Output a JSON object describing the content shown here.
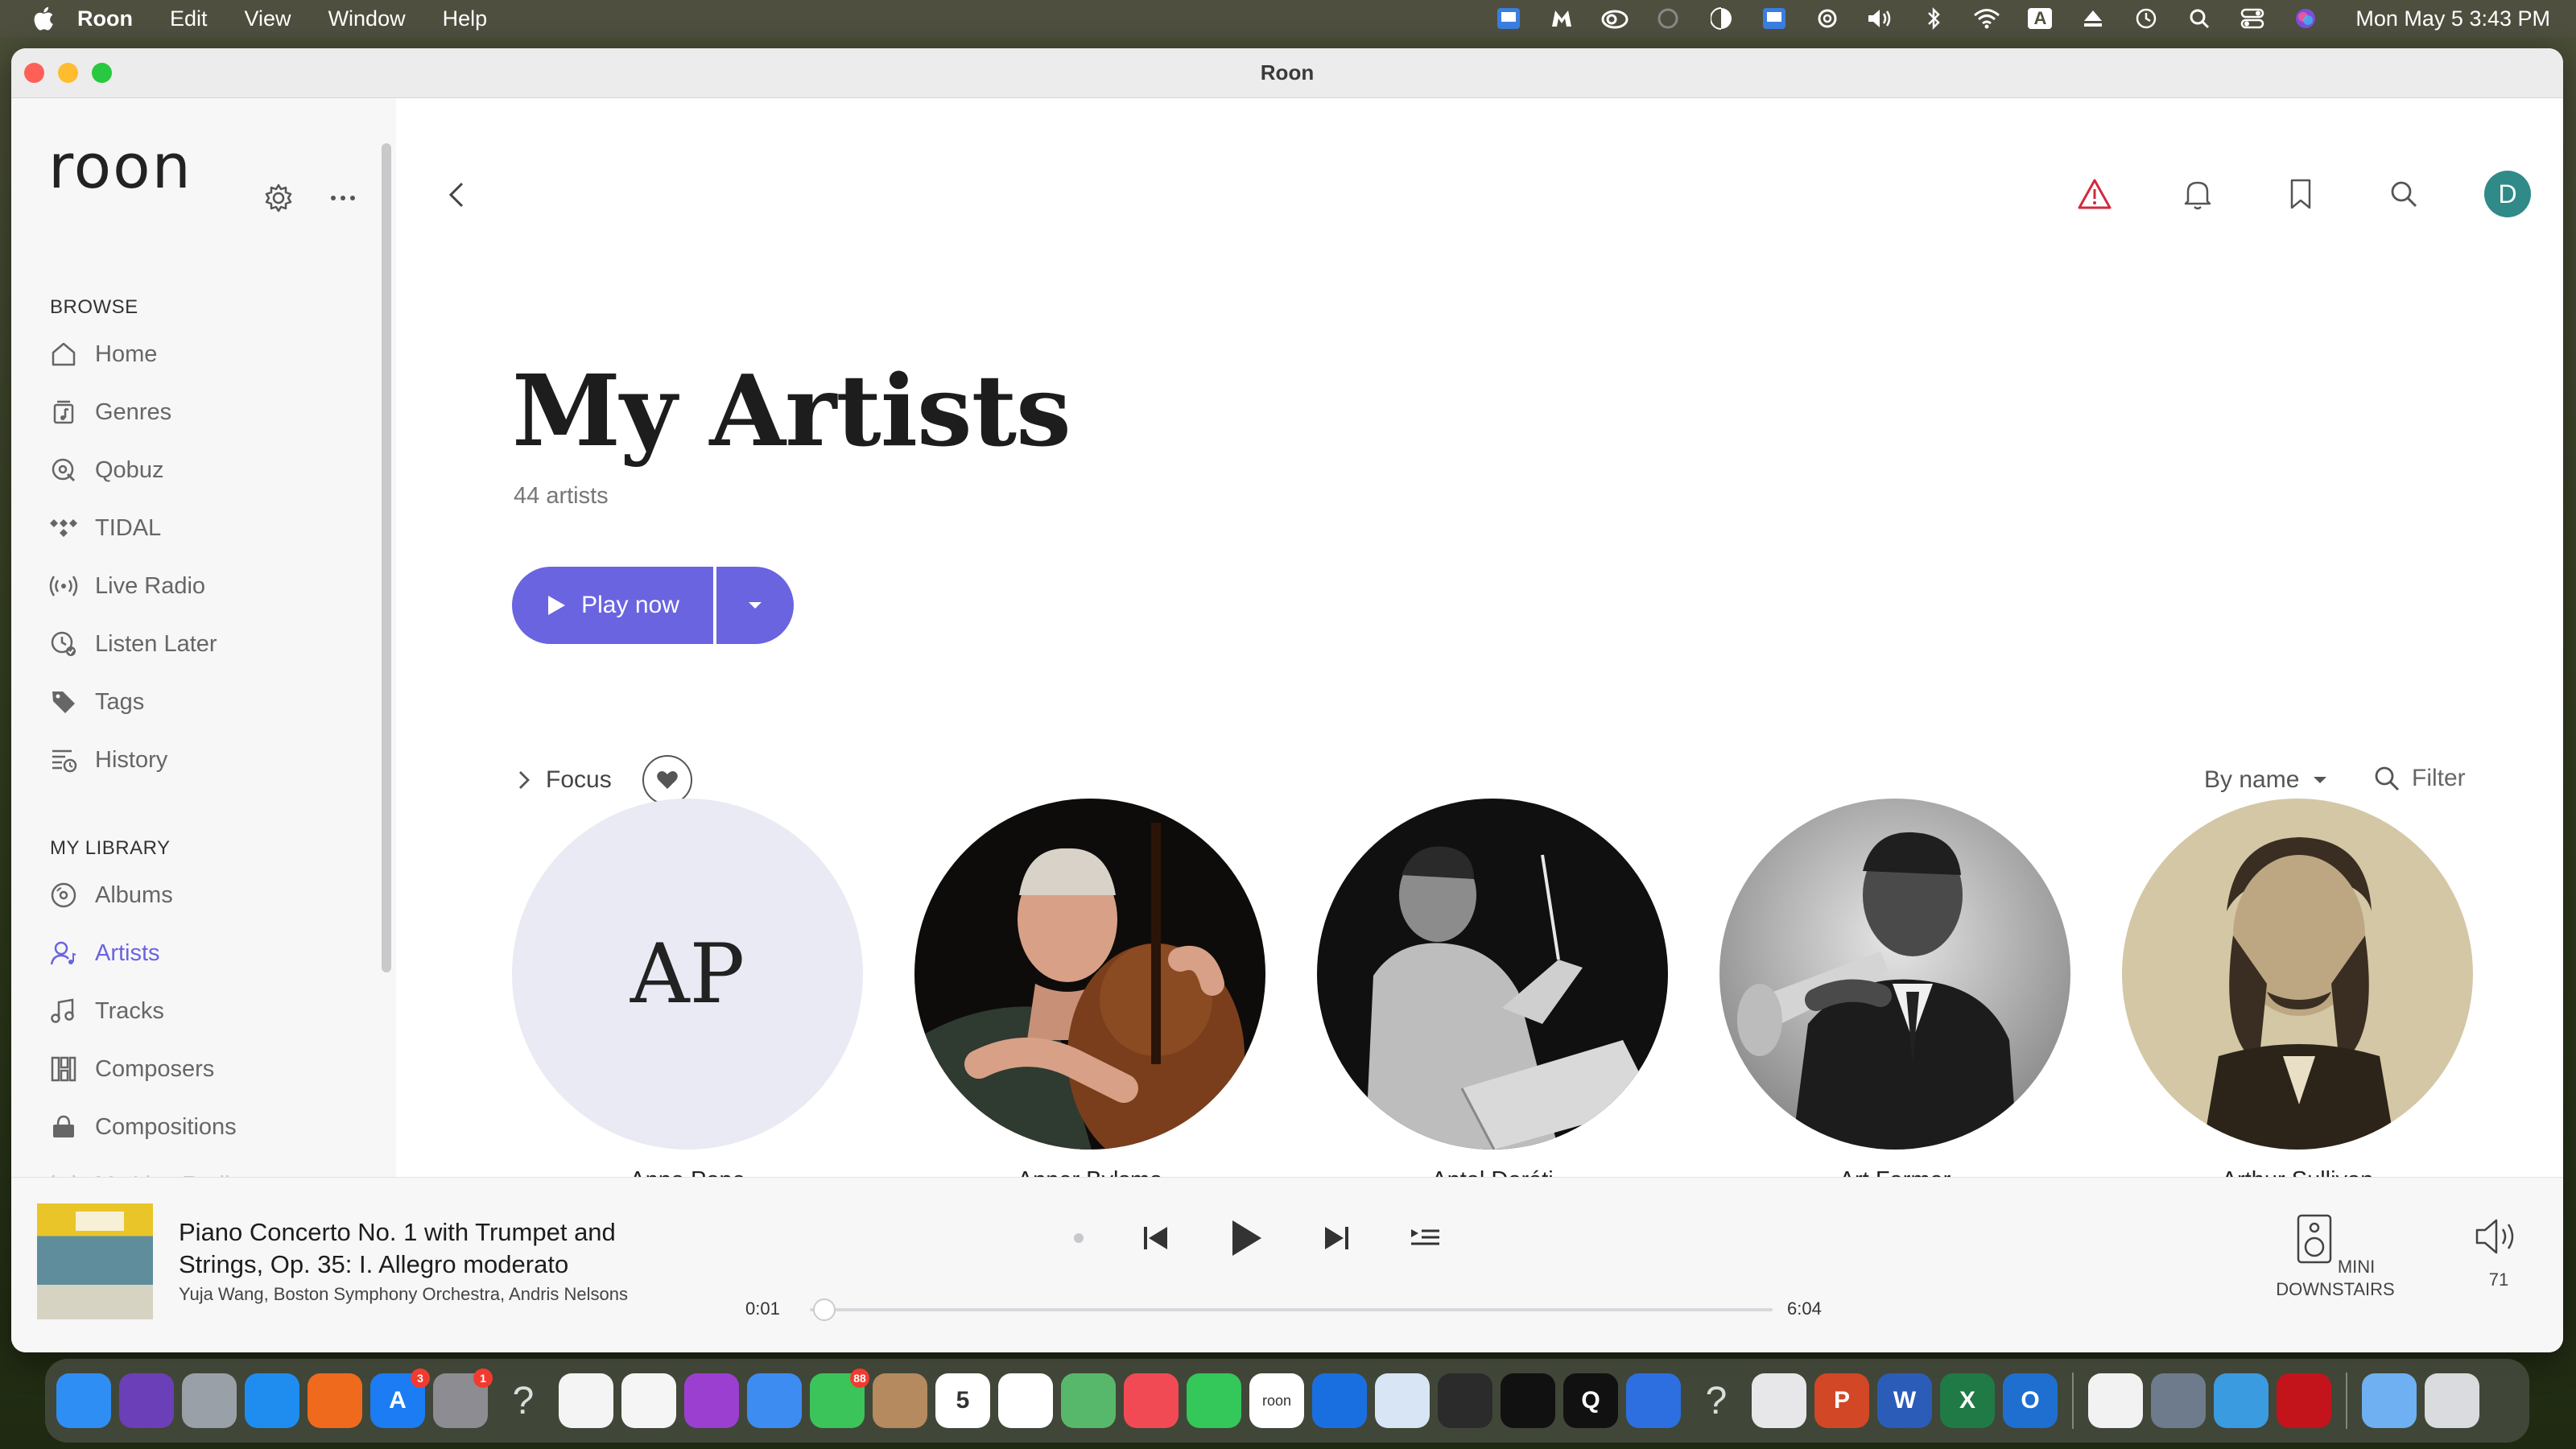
{
  "menubar": {
    "app_name": "Roon",
    "items": [
      "Edit",
      "View",
      "Window",
      "Help"
    ],
    "clock": "Mon May 5  3:43 PM",
    "input_indicator": "A"
  },
  "window": {
    "title": "Roon"
  },
  "sidebar": {
    "logo": "roon",
    "browse_title": "BROWSE",
    "browse_items": [
      {
        "label": "Home",
        "icon": "home-icon"
      },
      {
        "label": "Genres",
        "icon": "genres-icon"
      },
      {
        "label": "Qobuz",
        "icon": "qobuz-icon"
      },
      {
        "label": "TIDAL",
        "icon": "tidal-icon"
      },
      {
        "label": "Live Radio",
        "icon": "radio-icon"
      },
      {
        "label": "Listen Later",
        "icon": "clock-check-icon"
      },
      {
        "label": "Tags",
        "icon": "tag-icon"
      },
      {
        "label": "History",
        "icon": "history-icon"
      }
    ],
    "library_title": "MY LIBRARY",
    "library_items": [
      {
        "label": "Albums",
        "icon": "album-icon"
      },
      {
        "label": "Artists",
        "icon": "artist-icon"
      },
      {
        "label": "Tracks",
        "icon": "note-icon"
      },
      {
        "label": "Composers",
        "icon": "composer-icon"
      },
      {
        "label": "Compositions",
        "icon": "composition-icon"
      },
      {
        "label": "My Live Radio",
        "icon": "radio-icon"
      }
    ],
    "active_item": "Artists"
  },
  "main": {
    "title": "My Artists",
    "count": "44 artists",
    "play_label": "Play now",
    "focus_label": "Focus",
    "sort_label": "By name",
    "filter_label": "Filter",
    "avatar_initial": "D",
    "artists": [
      {
        "name": "Anna Pope",
        "initials": "AP"
      },
      {
        "name": "Anner Bylsma",
        "initials": ""
      },
      {
        "name": "Antal Doráti",
        "initials": ""
      },
      {
        "name": "Art Farmer",
        "initials": ""
      },
      {
        "name": "Arthur Sullivan",
        "initials": ""
      }
    ]
  },
  "player": {
    "track_title": "Piano Concerto No. 1 with Trumpet and Strings, Op. 35: I. Allegro moderato",
    "track_artist": "Yuja Wang, Boston Symphony Orchestra, Andris Nelsons",
    "time_elapsed": "0:01",
    "time_total": "6:04",
    "progress_fraction": 0.003,
    "zone_name": "MINI DOWNSTAIRS",
    "volume": "71"
  },
  "dock": {
    "apps": [
      {
        "name": "finder",
        "color": "#2f8ef3",
        "label": ""
      },
      {
        "name": "siri",
        "color": "#6b3fb8",
        "label": ""
      },
      {
        "name": "launchpad",
        "color": "#9aa0a8",
        "label": ""
      },
      {
        "name": "safari",
        "color": "#1f8df0",
        "label": ""
      },
      {
        "name": "firefox",
        "color": "#f06a1d",
        "label": ""
      },
      {
        "name": "app-store",
        "color": "#1b7cf3",
        "label": "A",
        "badge": "3"
      },
      {
        "name": "system-settings",
        "color": "#8c8c92",
        "label": "",
        "badge": "1"
      },
      {
        "name": "unknown",
        "color": "transparent",
        "label": "?"
      },
      {
        "name": "chrome",
        "color": "#f4f4f4",
        "label": ""
      },
      {
        "name": "photos",
        "color": "#f5f5f5",
        "label": ""
      },
      {
        "name": "podcasts",
        "color": "#9b3fd1",
        "label": ""
      },
      {
        "name": "mail",
        "color": "#3d8cf2",
        "label": ""
      },
      {
        "name": "messages",
        "color": "#3ac45a",
        "label": "",
        "badge": "88"
      },
      {
        "name": "contacts",
        "color": "#b48a5e",
        "label": ""
      },
      {
        "name": "calendar",
        "color": "#ffffff",
        "label": "5"
      },
      {
        "name": "reminders",
        "color": "#ffffff",
        "label": ""
      },
      {
        "name": "maps",
        "color": "#57b86b",
        "label": ""
      },
      {
        "name": "news",
        "color": "#f24a55",
        "label": ""
      },
      {
        "name": "facetime",
        "color": "#34c759",
        "label": ""
      },
      {
        "name": "roon",
        "color": "#ffffff",
        "label": "roon"
      },
      {
        "name": "teamviewer",
        "color": "#1a6fe0",
        "label": ""
      },
      {
        "name": "translator",
        "color": "#d7e5f5",
        "label": ""
      },
      {
        "name": "bbedit",
        "color": "#2b2b2b",
        "label": ""
      },
      {
        "name": "tidal",
        "color": "#111111",
        "label": ""
      },
      {
        "name": "qobuz",
        "color": "#111111",
        "label": "Q"
      },
      {
        "name": "screen-sharing",
        "color": "#2d6fe0",
        "label": ""
      },
      {
        "name": "unknown",
        "color": "transparent",
        "label": "?"
      },
      {
        "name": "preview",
        "color": "#e7e7ea",
        "label": ""
      },
      {
        "name": "powerpoint",
        "color": "#d24726",
        "label": "P"
      },
      {
        "name": "word",
        "color": "#2b5cb8",
        "label": "W"
      },
      {
        "name": "excel",
        "color": "#1f7a45",
        "label": "X"
      },
      {
        "name": "outlook",
        "color": "#1f6fd1",
        "label": "O"
      },
      {
        "name": "installer",
        "color": "#f2f2f2",
        "label": ""
      },
      {
        "name": "iphone-mirroring",
        "color": "#6e7b8c",
        "label": ""
      },
      {
        "name": "network-utility",
        "color": "#3b9be0",
        "label": ""
      },
      {
        "name": "acrobat",
        "color": "#c4141b",
        "label": ""
      },
      {
        "name": "downloads-folder",
        "color": "#6eb0f2",
        "label": ""
      },
      {
        "name": "trash",
        "color": "#d9dbde",
        "label": ""
      }
    ]
  }
}
